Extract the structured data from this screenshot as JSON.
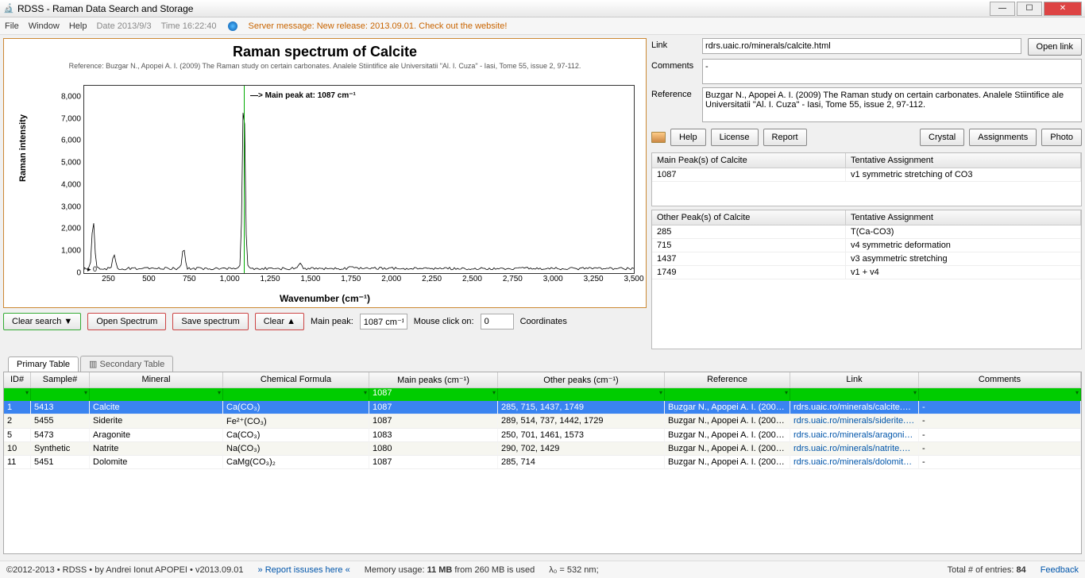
{
  "window": {
    "title": "RDSS - Raman Data Search and Storage"
  },
  "menu": {
    "file": "File",
    "window": "Window",
    "help": "Help",
    "date": "Date 2013/9/3",
    "time": "Time 16:22:40",
    "server": "Server message: New release: 2013.09.01. Check out the website!"
  },
  "chart_data": {
    "type": "line",
    "title": "Raman spectrum of Calcite",
    "subtitle": "Reference: Buzgar N., Apopei A. I. (2009) The Raman study on certain carbonates. Analele Stiintifice ale Universitatii \"Al. I. Cuza\" - Iasi, Tome 55, issue 2, 97-112.",
    "xlabel": "Wavenumber (cm⁻¹)",
    "ylabel": "Raman intensity",
    "xlim": [
      100,
      3500
    ],
    "ylim": [
      0,
      8500
    ],
    "xticks": [
      250,
      500,
      750,
      1000,
      1250,
      1500,
      1750,
      2000,
      2250,
      2500,
      2750,
      3000,
      3250,
      3500
    ],
    "yticks": [
      0,
      1000,
      2000,
      3000,
      4000,
      5000,
      6000,
      7000,
      8000
    ],
    "annotation": "—> Main peak at: 1087 cm⁻¹",
    "main_peak_x": 1087,
    "series": [
      {
        "name": "Calcite",
        "peaks": [
          {
            "x": 156,
            "y": 2300
          },
          {
            "x": 285,
            "y": 800
          },
          {
            "x": 715,
            "y": 1100
          },
          {
            "x": 1087,
            "y": 8200
          },
          {
            "x": 1437,
            "y": 400
          },
          {
            "x": 1749,
            "y": 250
          }
        ],
        "baseline": 150
      }
    ]
  },
  "chartctrl": {
    "clear_search": "Clear search ▼",
    "open_spectrum": "Open Spectrum",
    "save_spectrum": "Save spectrum",
    "clear": "Clear ▲",
    "main_peak_label": "Main peak:",
    "main_peak_value": "1087 cm⁻¹",
    "mouse_label": "Mouse click on:",
    "mouse_value": "0",
    "coord_label": "Coordinates"
  },
  "side": {
    "link_label": "Link",
    "link_value": "rdrs.uaic.ro/minerals/calcite.html",
    "open_link": "Open link",
    "comments_label": "Comments",
    "comments_value": "-",
    "reference_label": "Reference",
    "reference_value": "Buzgar N., Apopei A. I. (2009) The Raman study on certain carbonates. Analele Stiintifice ale Universitatii \"Al. I. Cuza\" - Iasi, Tome 55, issue 2, 97-112.",
    "help": "Help",
    "license": "License",
    "report": "Report",
    "crystal": "Crystal",
    "assignments": "Assignments",
    "photo": "Photo",
    "main_peaks_hdr": "Main Peak(s) of Calcite",
    "tentative_hdr": "Tentative Assignment",
    "main_peaks": [
      {
        "peak": "1087",
        "assign": "v1 symmetric stretching of CO3"
      }
    ],
    "other_peaks_hdr": "Other Peak(s) of Calcite",
    "other_peaks": [
      {
        "peak": "285",
        "assign": "T(Ca-CO3)"
      },
      {
        "peak": "715",
        "assign": "v4 symmetric deformation"
      },
      {
        "peak": "1437",
        "assign": "v3 asymmetric stretching"
      },
      {
        "peak": "1749",
        "assign": "v1 + v4"
      }
    ]
  },
  "tabs": {
    "primary": "Primary Table",
    "secondary": "Secondary Table"
  },
  "table": {
    "headers": {
      "id": "ID#",
      "sample": "Sample#",
      "mineral": "Mineral",
      "formula": "Chemical Formula",
      "mainpeaks": "Main peaks (cm⁻¹)",
      "otherpeaks": "Other peaks (cm⁻¹)",
      "reference": "Reference",
      "link": "Link",
      "comments": "Comments"
    },
    "filter_mainpeaks": "1087",
    "rows": [
      {
        "id": "1",
        "sample": "5413",
        "mineral": "Calcite",
        "formula": "Ca(CO₃)",
        "mainpeaks": "1087",
        "otherpeaks": "285, 715, 1437, 1749",
        "reference": "Buzgar N., Apopei A. I. (2009...",
        "link": "rdrs.uaic.ro/minerals/calcite.html",
        "comments": "-",
        "selected": true
      },
      {
        "id": "2",
        "sample": "5455",
        "mineral": "Siderite",
        "formula": "Fe²⁺(CO₃)",
        "mainpeaks": "1087",
        "otherpeaks": "289, 514, 737, 1442, 1729",
        "reference": "Buzgar N., Apopei A. I. (2009...",
        "link": "rdrs.uaic.ro/minerals/siderite.h…",
        "comments": "-"
      },
      {
        "id": "5",
        "sample": "5473",
        "mineral": "Aragonite",
        "formula": "Ca(CO₃)",
        "mainpeaks": "1083",
        "otherpeaks": "250, 701, 1461, 1573",
        "reference": "Buzgar N., Apopei A. I. (2009...",
        "link": "rdrs.uaic.ro/minerals/aragonit…",
        "comments": "-"
      },
      {
        "id": "10",
        "sample": "Synthetic",
        "mineral": "Natrite",
        "formula": "Na(CO₃)",
        "mainpeaks": "1080",
        "otherpeaks": "290, 702, 1429",
        "reference": "Buzgar N., Apopei A. I. (2009...",
        "link": "rdrs.uaic.ro/minerals/natrite.html",
        "comments": "-"
      },
      {
        "id": "11",
        "sample": "5451",
        "mineral": "Dolomite",
        "formula": "CaMg(CO₃)₂",
        "mainpeaks": "1087",
        "otherpeaks": "285, 714",
        "reference": "Buzgar N., Apopei A. I. (2009...",
        "link": "rdrs.uaic.ro/minerals/dolomite.…",
        "comments": "-"
      }
    ]
  },
  "status": {
    "copyright": "©2012-2013 • RDSS • by Andrei Ionut APOPEI • v2013.09.01",
    "report": "» Report issuses here «",
    "memory": "Memory usage: 11 MB from 260 MB is used",
    "lambda": "λ₀ = 532 nm;",
    "total": "Total # of entries: 84",
    "feedback": "Feedback"
  }
}
